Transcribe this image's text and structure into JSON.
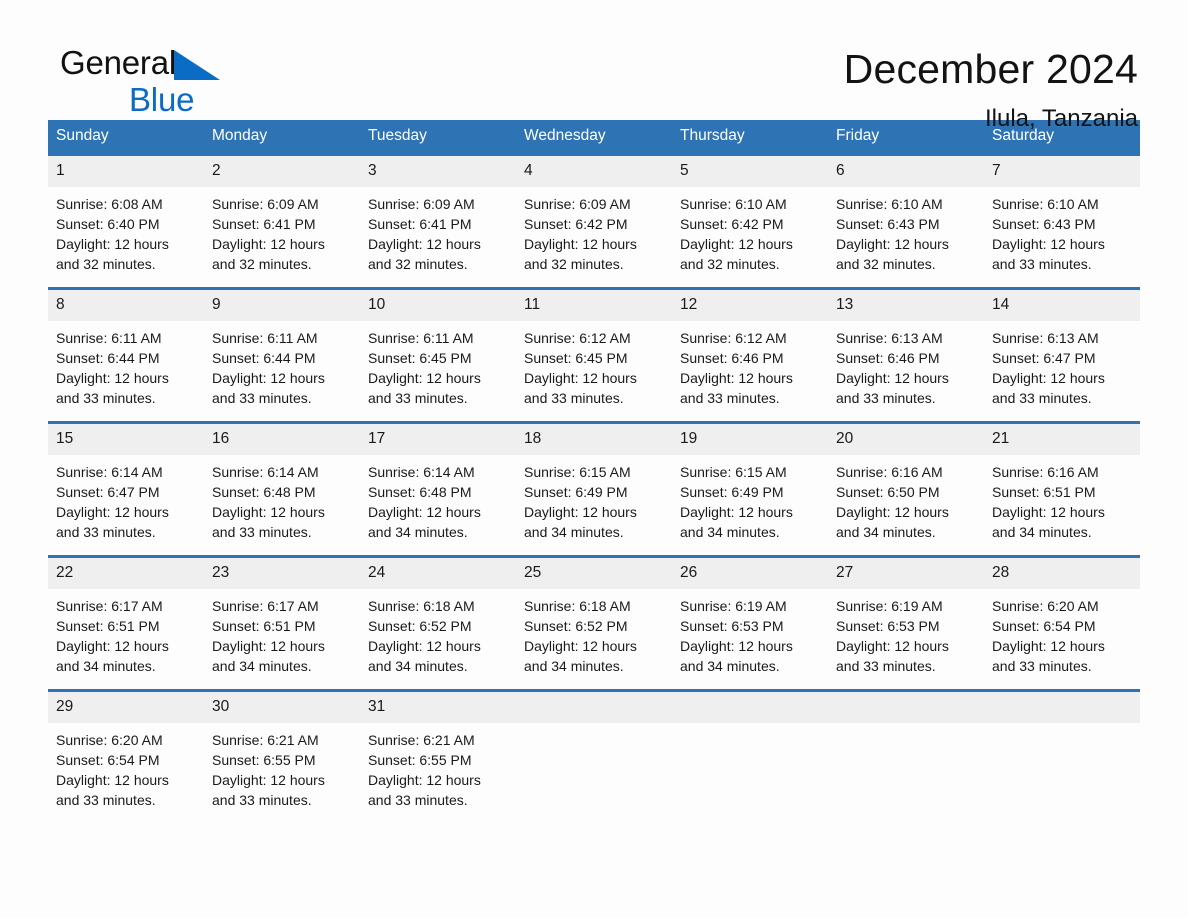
{
  "brand": {
    "line1": "General",
    "line2": "Blue",
    "mark": "triangle-logo"
  },
  "header": {
    "title": "December 2024",
    "subtitle": "Ilula, Tanzania"
  },
  "colors": {
    "header_blue": "#2e74b5",
    "daynum_gray": "#efefef",
    "brand_blue": "#0a6cc4",
    "page_bg": "#fdfdfd",
    "text": "#1a1a1a"
  },
  "weekdays": [
    "Sunday",
    "Monday",
    "Tuesday",
    "Wednesday",
    "Thursday",
    "Friday",
    "Saturday"
  ],
  "labels": {
    "sunrise": "Sunrise:",
    "sunset": "Sunset:",
    "daylight": "Daylight:"
  },
  "weeks": [
    [
      {
        "day": "1",
        "sunrise": "Sunrise: 6:08 AM",
        "sunset": "Sunset: 6:40 PM",
        "daylight1": "Daylight: 12 hours",
        "daylight2": "and 32 minutes."
      },
      {
        "day": "2",
        "sunrise": "Sunrise: 6:09 AM",
        "sunset": "Sunset: 6:41 PM",
        "daylight1": "Daylight: 12 hours",
        "daylight2": "and 32 minutes."
      },
      {
        "day": "3",
        "sunrise": "Sunrise: 6:09 AM",
        "sunset": "Sunset: 6:41 PM",
        "daylight1": "Daylight: 12 hours",
        "daylight2": "and 32 minutes."
      },
      {
        "day": "4",
        "sunrise": "Sunrise: 6:09 AM",
        "sunset": "Sunset: 6:42 PM",
        "daylight1": "Daylight: 12 hours",
        "daylight2": "and 32 minutes."
      },
      {
        "day": "5",
        "sunrise": "Sunrise: 6:10 AM",
        "sunset": "Sunset: 6:42 PM",
        "daylight1": "Daylight: 12 hours",
        "daylight2": "and 32 minutes."
      },
      {
        "day": "6",
        "sunrise": "Sunrise: 6:10 AM",
        "sunset": "Sunset: 6:43 PM",
        "daylight1": "Daylight: 12 hours",
        "daylight2": "and 32 minutes."
      },
      {
        "day": "7",
        "sunrise": "Sunrise: 6:10 AM",
        "sunset": "Sunset: 6:43 PM",
        "daylight1": "Daylight: 12 hours",
        "daylight2": "and 33 minutes."
      }
    ],
    [
      {
        "day": "8",
        "sunrise": "Sunrise: 6:11 AM",
        "sunset": "Sunset: 6:44 PM",
        "daylight1": "Daylight: 12 hours",
        "daylight2": "and 33 minutes."
      },
      {
        "day": "9",
        "sunrise": "Sunrise: 6:11 AM",
        "sunset": "Sunset: 6:44 PM",
        "daylight1": "Daylight: 12 hours",
        "daylight2": "and 33 minutes."
      },
      {
        "day": "10",
        "sunrise": "Sunrise: 6:11 AM",
        "sunset": "Sunset: 6:45 PM",
        "daylight1": "Daylight: 12 hours",
        "daylight2": "and 33 minutes."
      },
      {
        "day": "11",
        "sunrise": "Sunrise: 6:12 AM",
        "sunset": "Sunset: 6:45 PM",
        "daylight1": "Daylight: 12 hours",
        "daylight2": "and 33 minutes."
      },
      {
        "day": "12",
        "sunrise": "Sunrise: 6:12 AM",
        "sunset": "Sunset: 6:46 PM",
        "daylight1": "Daylight: 12 hours",
        "daylight2": "and 33 minutes."
      },
      {
        "day": "13",
        "sunrise": "Sunrise: 6:13 AM",
        "sunset": "Sunset: 6:46 PM",
        "daylight1": "Daylight: 12 hours",
        "daylight2": "and 33 minutes."
      },
      {
        "day": "14",
        "sunrise": "Sunrise: 6:13 AM",
        "sunset": "Sunset: 6:47 PM",
        "daylight1": "Daylight: 12 hours",
        "daylight2": "and 33 minutes."
      }
    ],
    [
      {
        "day": "15",
        "sunrise": "Sunrise: 6:14 AM",
        "sunset": "Sunset: 6:47 PM",
        "daylight1": "Daylight: 12 hours",
        "daylight2": "and 33 minutes."
      },
      {
        "day": "16",
        "sunrise": "Sunrise: 6:14 AM",
        "sunset": "Sunset: 6:48 PM",
        "daylight1": "Daylight: 12 hours",
        "daylight2": "and 33 minutes."
      },
      {
        "day": "17",
        "sunrise": "Sunrise: 6:14 AM",
        "sunset": "Sunset: 6:48 PM",
        "daylight1": "Daylight: 12 hours",
        "daylight2": "and 34 minutes."
      },
      {
        "day": "18",
        "sunrise": "Sunrise: 6:15 AM",
        "sunset": "Sunset: 6:49 PM",
        "daylight1": "Daylight: 12 hours",
        "daylight2": "and 34 minutes."
      },
      {
        "day": "19",
        "sunrise": "Sunrise: 6:15 AM",
        "sunset": "Sunset: 6:49 PM",
        "daylight1": "Daylight: 12 hours",
        "daylight2": "and 34 minutes."
      },
      {
        "day": "20",
        "sunrise": "Sunrise: 6:16 AM",
        "sunset": "Sunset: 6:50 PM",
        "daylight1": "Daylight: 12 hours",
        "daylight2": "and 34 minutes."
      },
      {
        "day": "21",
        "sunrise": "Sunrise: 6:16 AM",
        "sunset": "Sunset: 6:51 PM",
        "daylight1": "Daylight: 12 hours",
        "daylight2": "and 34 minutes."
      }
    ],
    [
      {
        "day": "22",
        "sunrise": "Sunrise: 6:17 AM",
        "sunset": "Sunset: 6:51 PM",
        "daylight1": "Daylight: 12 hours",
        "daylight2": "and 34 minutes."
      },
      {
        "day": "23",
        "sunrise": "Sunrise: 6:17 AM",
        "sunset": "Sunset: 6:51 PM",
        "daylight1": "Daylight: 12 hours",
        "daylight2": "and 34 minutes."
      },
      {
        "day": "24",
        "sunrise": "Sunrise: 6:18 AM",
        "sunset": "Sunset: 6:52 PM",
        "daylight1": "Daylight: 12 hours",
        "daylight2": "and 34 minutes."
      },
      {
        "day": "25",
        "sunrise": "Sunrise: 6:18 AM",
        "sunset": "Sunset: 6:52 PM",
        "daylight1": "Daylight: 12 hours",
        "daylight2": "and 34 minutes."
      },
      {
        "day": "26",
        "sunrise": "Sunrise: 6:19 AM",
        "sunset": "Sunset: 6:53 PM",
        "daylight1": "Daylight: 12 hours",
        "daylight2": "and 34 minutes."
      },
      {
        "day": "27",
        "sunrise": "Sunrise: 6:19 AM",
        "sunset": "Sunset: 6:53 PM",
        "daylight1": "Daylight: 12 hours",
        "daylight2": "and 33 minutes."
      },
      {
        "day": "28",
        "sunrise": "Sunrise: 6:20 AM",
        "sunset": "Sunset: 6:54 PM",
        "daylight1": "Daylight: 12 hours",
        "daylight2": "and 33 minutes."
      }
    ],
    [
      {
        "day": "29",
        "sunrise": "Sunrise: 6:20 AM",
        "sunset": "Sunset: 6:54 PM",
        "daylight1": "Daylight: 12 hours",
        "daylight2": "and 33 minutes."
      },
      {
        "day": "30",
        "sunrise": "Sunrise: 6:21 AM",
        "sunset": "Sunset: 6:55 PM",
        "daylight1": "Daylight: 12 hours",
        "daylight2": "and 33 minutes."
      },
      {
        "day": "31",
        "sunrise": "Sunrise: 6:21 AM",
        "sunset": "Sunset: 6:55 PM",
        "daylight1": "Daylight: 12 hours",
        "daylight2": "and 33 minutes."
      },
      {
        "day": "",
        "sunrise": "",
        "sunset": "",
        "daylight1": "",
        "daylight2": ""
      },
      {
        "day": "",
        "sunrise": "",
        "sunset": "",
        "daylight1": "",
        "daylight2": ""
      },
      {
        "day": "",
        "sunrise": "",
        "sunset": "",
        "daylight1": "",
        "daylight2": ""
      },
      {
        "day": "",
        "sunrise": "",
        "sunset": "",
        "daylight1": "",
        "daylight2": ""
      }
    ]
  ]
}
